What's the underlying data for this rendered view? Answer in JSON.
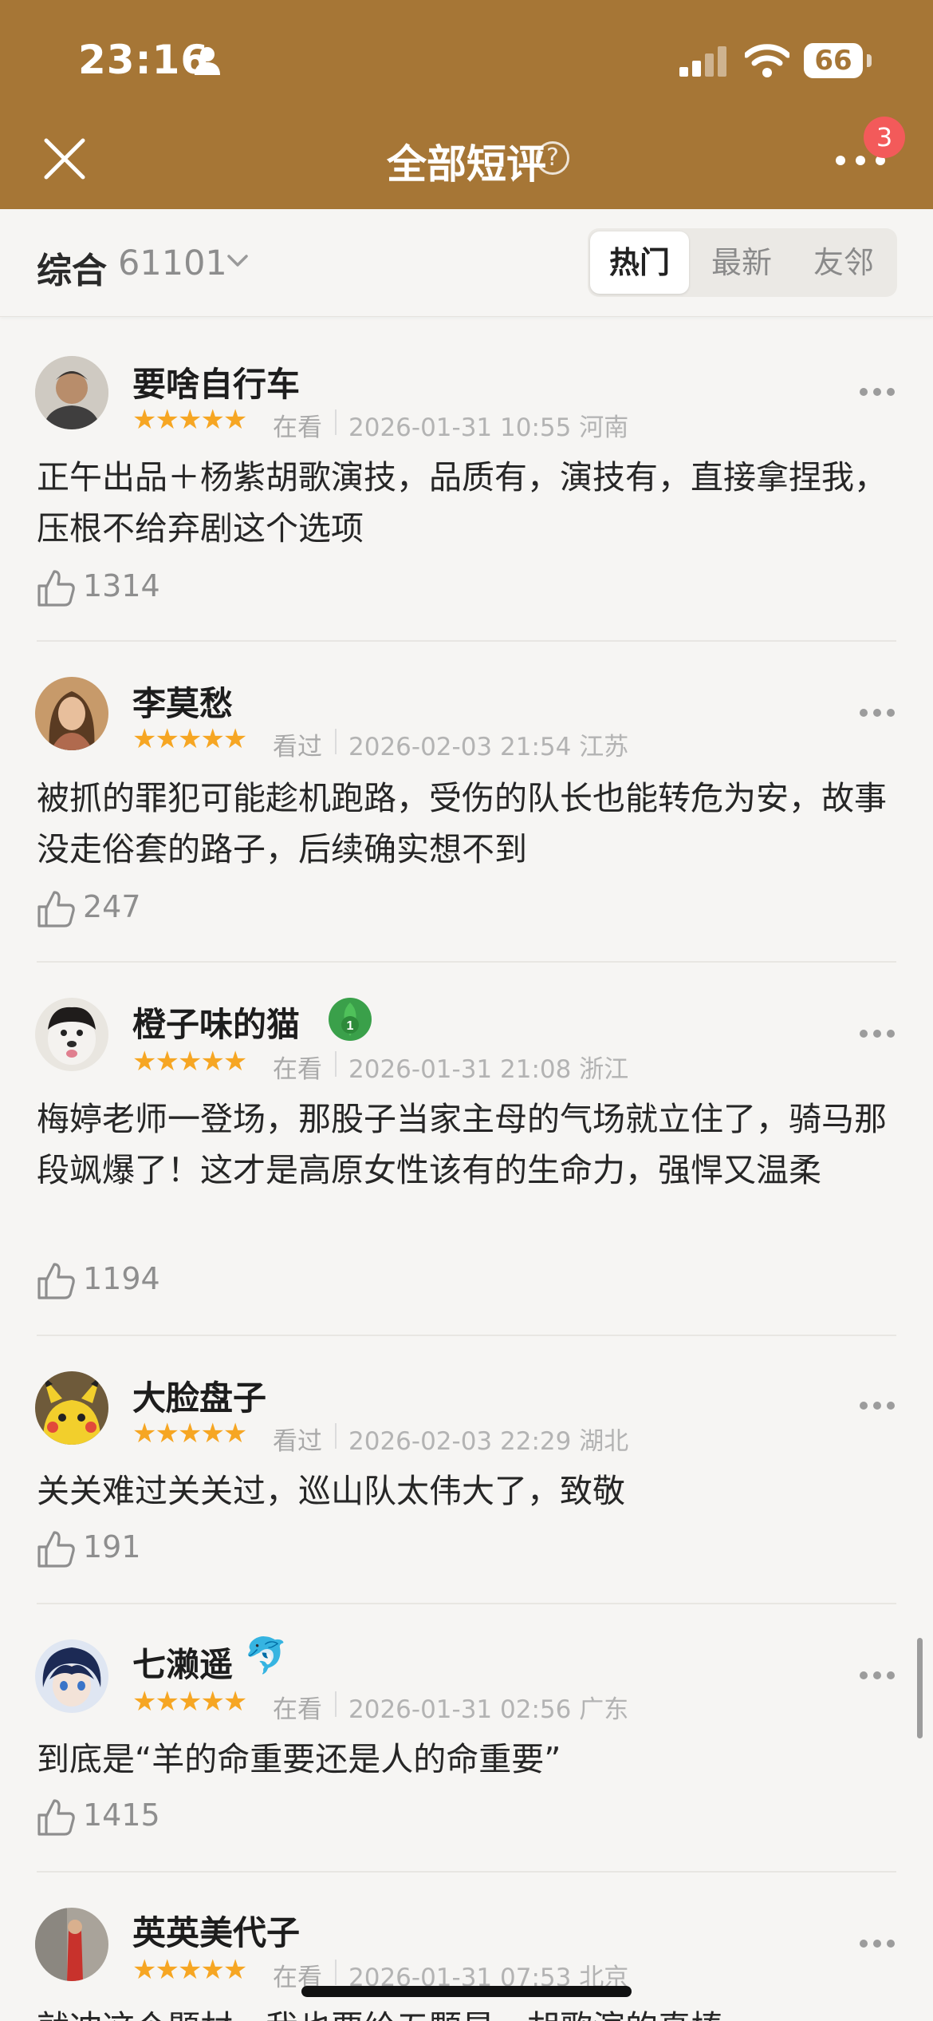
{
  "status_bar": {
    "time": "23:16",
    "battery": "66"
  },
  "header": {
    "title": "全部短评",
    "notification_count": "3"
  },
  "filter": {
    "sort_label": "综合",
    "total_count": "61101",
    "tabs": [
      "热门",
      "最新",
      "友邻"
    ],
    "active_tab": "热门"
  },
  "reviews": [
    {
      "name": "要啥自行车",
      "stars": "★★★★★",
      "status": "在看",
      "meta": "2026-01-31 10:55 河南",
      "text": "正午出品＋杨紫胡歌演技，品质有，演技有，直接拿捏我，压根不给弃剧这个选项",
      "likes": "1314"
    },
    {
      "name": "李莫愁",
      "stars": "★★★★★",
      "status": "看过",
      "meta": "2026-02-03 21:54 江苏",
      "text": "被抓的罪犯可能趁机跑路，受伤的队长也能转危为安，故事没走俗套的路子，后续确实想不到",
      "likes": "247"
    },
    {
      "name": "橙子味的猫",
      "badge_number": "1",
      "stars": "★★★★★",
      "status": "在看",
      "meta": "2026-01-31 21:08 浙江",
      "text": "梅婷老师一登场，那股子当家主母的气场就立住了，骑马那段飒爆了！这才是高原女性该有的生命力，强悍又温柔",
      "likes": "1194"
    },
    {
      "name": "大脸盘子",
      "stars": "★★★★★",
      "status": "看过",
      "meta": "2026-02-03 22:29 湖北",
      "text": "关关难过关关过，巡山队太伟大了，致敬",
      "likes": "191"
    },
    {
      "name": "七濑遥",
      "name_emoji": "🐬",
      "stars": "★★★★★",
      "status": "在看",
      "meta": "2026-01-31 02:56 广东",
      "text": "到底是“羊的命重要还是人的命重要”",
      "likes": "1415"
    },
    {
      "name": "英英美代子",
      "stars": "★★★★★",
      "status": "在看",
      "meta": "2026-01-31 07:53 北京",
      "text": "就冲这个题材，我也要给五颗星，胡歌演的真棒",
      "likes": ""
    }
  ],
  "colors": {
    "header_bg": "#a67636",
    "star": "#f6a623",
    "badge": "#f35a5a"
  }
}
